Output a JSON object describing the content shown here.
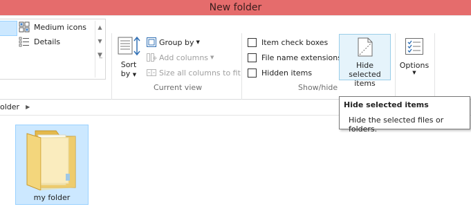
{
  "window": {
    "title": "New folder"
  },
  "ribbon": {
    "layout": {
      "items": [
        {
          "label": "Medium icons",
          "icon": "medium-icons-icon"
        },
        {
          "label": "Details",
          "icon": "details-view-icon"
        }
      ]
    },
    "current_view": {
      "group_label": "Current view",
      "sort_by": {
        "line1": "Sort",
        "line2": "by"
      },
      "group_by": "Group by",
      "add_columns": "Add columns",
      "size_all_columns": "Size all columns to fit"
    },
    "show_hide": {
      "group_label": "Show/hide",
      "item_check_boxes": "Item check boxes",
      "file_name_extensions": "File name extensions",
      "hidden_items": "Hidden items",
      "hide_selected": {
        "line1": "Hide selected",
        "line2": "items"
      }
    },
    "options": {
      "label": "Options"
    }
  },
  "address_bar": {
    "crumb": "older"
  },
  "content": {
    "items": [
      {
        "name": "my folder",
        "selected": true
      }
    ]
  },
  "tooltip": {
    "title": "Hide selected items",
    "body": "Hide the selected files or folders."
  },
  "colors": {
    "title_bar": "#e56c6c",
    "selection": "#cce8ff",
    "selection_border": "#99d1ff"
  }
}
